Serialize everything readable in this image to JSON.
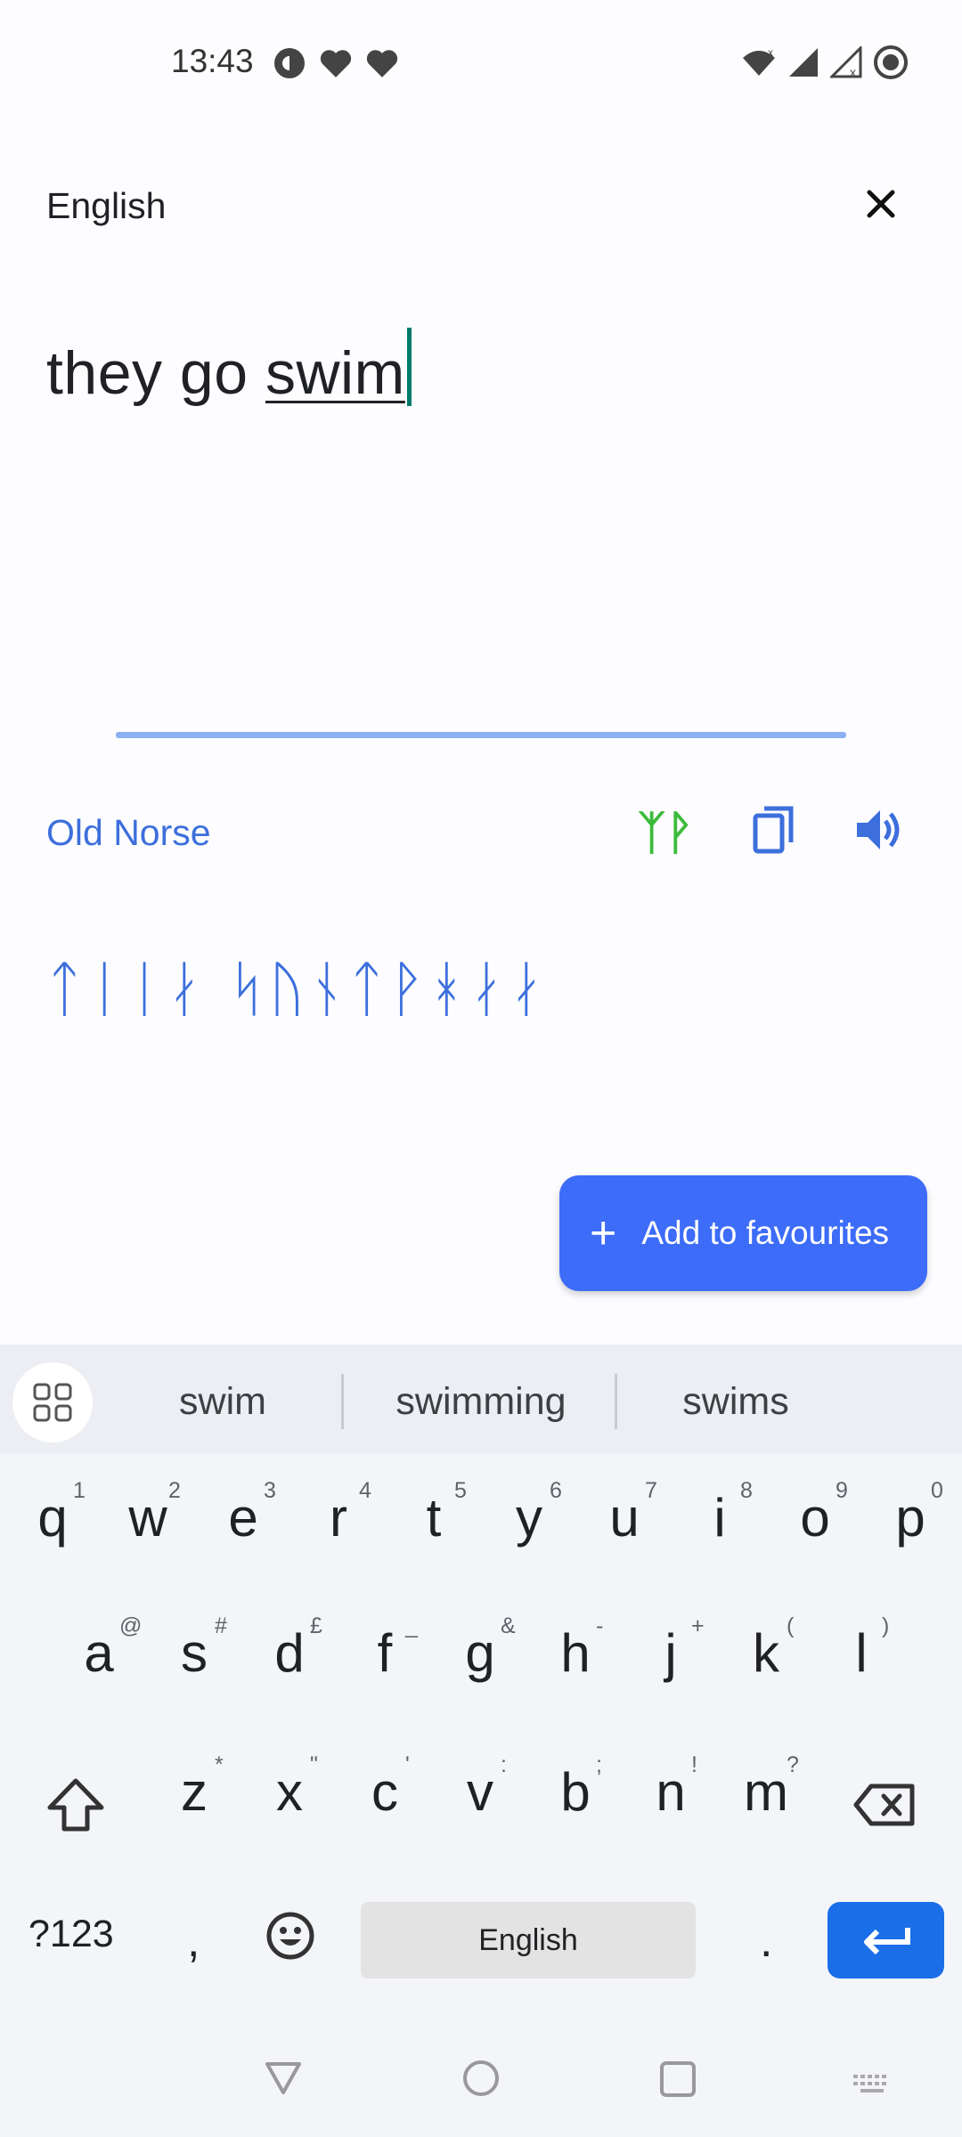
{
  "status_bar": {
    "time": "13:43",
    "left_icons": [
      "pocket-casts-icon",
      "heart-icon",
      "heart-icon"
    ],
    "right_icons": [
      "wifi-icon",
      "signal-icon",
      "signal-off-icon",
      "record-icon"
    ]
  },
  "source": {
    "language": "English",
    "text_plain": "they go ",
    "text_composing": "swim"
  },
  "target": {
    "language": "Old Norse",
    "runic_toggle_label": "ᛉᚹ",
    "text": "ᛏᛁᛁᛅ ᛋᚢᚾᛏᚹᚼᛅᛅ"
  },
  "favourites_button": {
    "label": "Add to favourites"
  },
  "keyboard": {
    "suggestions": [
      "swim",
      "swimming",
      "swims"
    ],
    "row1": [
      {
        "k": "q",
        "h": "1"
      },
      {
        "k": "w",
        "h": "2"
      },
      {
        "k": "e",
        "h": "3"
      },
      {
        "k": "r",
        "h": "4"
      },
      {
        "k": "t",
        "h": "5"
      },
      {
        "k": "y",
        "h": "6"
      },
      {
        "k": "u",
        "h": "7"
      },
      {
        "k": "i",
        "h": "8"
      },
      {
        "k": "o",
        "h": "9"
      },
      {
        "k": "p",
        "h": "0"
      }
    ],
    "row2": [
      {
        "k": "a",
        "h": "@"
      },
      {
        "k": "s",
        "h": "#"
      },
      {
        "k": "d",
        "h": "£"
      },
      {
        "k": "f",
        "h": "_"
      },
      {
        "k": "g",
        "h": "&"
      },
      {
        "k": "h",
        "h": "-"
      },
      {
        "k": "j",
        "h": "+"
      },
      {
        "k": "k",
        "h": "("
      },
      {
        "k": "l",
        "h": ")"
      }
    ],
    "row3": [
      {
        "k": "z",
        "h": "*"
      },
      {
        "k": "x",
        "h": "\""
      },
      {
        "k": "c",
        "h": "'"
      },
      {
        "k": "v",
        "h": ":"
      },
      {
        "k": "b",
        "h": ";"
      },
      {
        "k": "n",
        "h": "!"
      },
      {
        "k": "m",
        "h": "?"
      }
    ],
    "symbols_label": "?123",
    "comma_label": ",",
    "space_label": "English",
    "period_label": "."
  },
  "colors": {
    "accent": "#3d6cf9",
    "target_text": "#3d6fdc",
    "rune_green": "#3cba3c",
    "enter_key": "#1a6ee8"
  }
}
